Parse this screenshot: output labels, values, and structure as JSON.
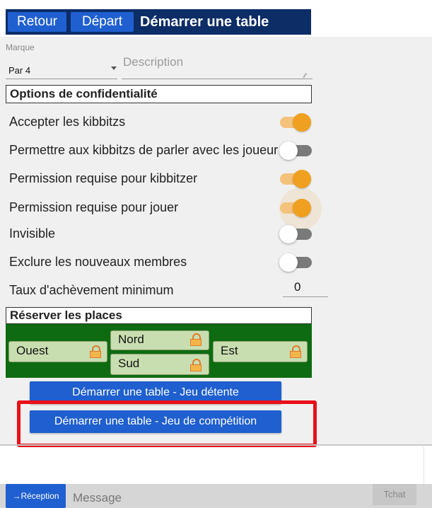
{
  "header": {
    "back_label": "Retour",
    "start_label": "Départ",
    "title": "Démarrer une table"
  },
  "form": {
    "brand_label": "Marque",
    "brand_value": "Par 4",
    "description_placeholder": "Description"
  },
  "privacy": {
    "heading": "Options de confidentialité",
    "options": [
      {
        "label": "Accepter les kibbitzs",
        "on": true
      },
      {
        "label": "Permettre aux kibbitzs de parler avec les joueurs",
        "on": false
      },
      {
        "label": "Permission requise pour kibbitzer",
        "on": true
      },
      {
        "label": "Permission requise pour jouer",
        "on": true
      },
      {
        "label": "Invisible",
        "on": false
      },
      {
        "label": "Exclure les nouveaux membres",
        "on": false
      }
    ],
    "min_completion_label": "Taux d'achèvement minimum",
    "min_completion_value": "0"
  },
  "seats": {
    "heading": "Réserver les places",
    "west": "Ouest",
    "north": "Nord",
    "south": "Sud",
    "east": "Est"
  },
  "actions": {
    "casual": "Démarrer une table - Jeu détente",
    "competitive": "Démarrer une table - Jeu de compétition"
  },
  "bottom": {
    "reception": "→Réception",
    "message_placeholder": "Message",
    "chat": "Tchat"
  },
  "colors": {
    "navy": "#0d2d67",
    "button_blue": "#1f5fcf",
    "toggle_orange": "#f0a020",
    "felt_green": "#0f6b12",
    "highlight_red": "#e8101a"
  }
}
